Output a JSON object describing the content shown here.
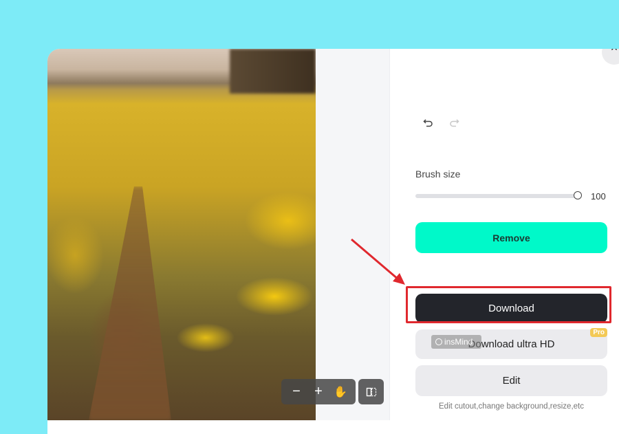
{
  "modal": {
    "close_icon": "×",
    "photo_alt": "Yellow rapeseed field with a dirt path"
  },
  "history": {
    "undo_icon": "↶",
    "redo_icon": "↷"
  },
  "brush": {
    "label": "Brush size",
    "value": "100",
    "value_fraction": 1.0
  },
  "canvas_toolbar": {
    "zoom_out_icon": "−",
    "zoom_in_icon": "+",
    "pan_icon": "✋",
    "compare_icon": "◫"
  },
  "actions": {
    "remove_label": "Remove",
    "download_label": "Download",
    "download_hd_label": "Download ultra HD",
    "pro_badge": "Pro",
    "edit_label": "Edit",
    "edit_hint": "Edit cutout,change background,resize,etc"
  },
  "watermark": {
    "text": "insMind"
  },
  "annotation": {
    "highlight_color": "#e0282e",
    "target": "Download"
  },
  "colors": {
    "background": "#7debf7",
    "remove_button": "#00f9c9",
    "download_button": "#23252b",
    "pro_badge": "#f3c956"
  }
}
